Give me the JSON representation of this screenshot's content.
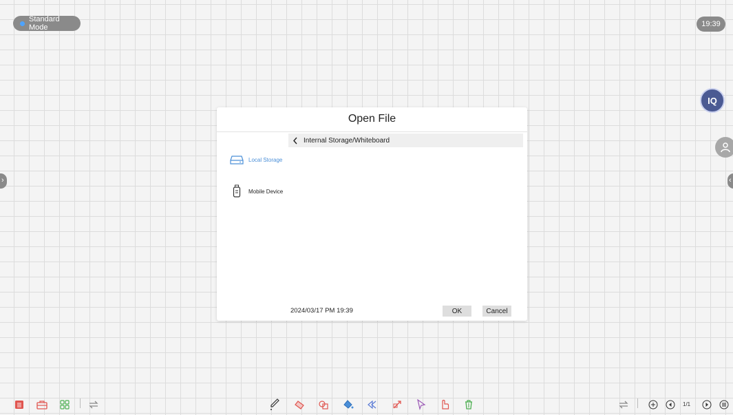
{
  "status": {
    "mode_label": "Standard Mode",
    "clock": "19:39"
  },
  "side": {
    "left_arrow": "›",
    "right_arrow": "‹"
  },
  "badges": {
    "iq_label": "IQ"
  },
  "dialog": {
    "title": "Open File",
    "path": "Internal Storage/Whiteboard",
    "sources": [
      {
        "label": "Local Storage",
        "icon": "hard-drive-icon",
        "selected": true
      },
      {
        "label": "Mobile Device",
        "icon": "usb-drive-icon",
        "selected": false
      }
    ],
    "timestamp": "2024/03/17 PM 19:39",
    "ok_label": "OK",
    "cancel_label": "Cancel"
  },
  "toolbar": {
    "left": [
      "menu-icon",
      "toolbox-icon",
      "apps-icon",
      "switch-icon"
    ],
    "center": [
      "pen-icon",
      "eraser-icon",
      "shapes-icon",
      "fill-icon",
      "undo-icon",
      "redo-icon",
      "select-icon",
      "multi-touch-icon",
      "clear-icon"
    ],
    "right": [
      "switch-icon",
      "new-page-icon",
      "previous-page-icon",
      "next-page-icon",
      "list-icon"
    ],
    "page_counter": "1/1"
  },
  "colors": {
    "accent": "#4a8fd8",
    "pill_gray": "#8a8a8a",
    "toolbar_red": "#e0554f",
    "toolbar_green": "#4caf50"
  }
}
